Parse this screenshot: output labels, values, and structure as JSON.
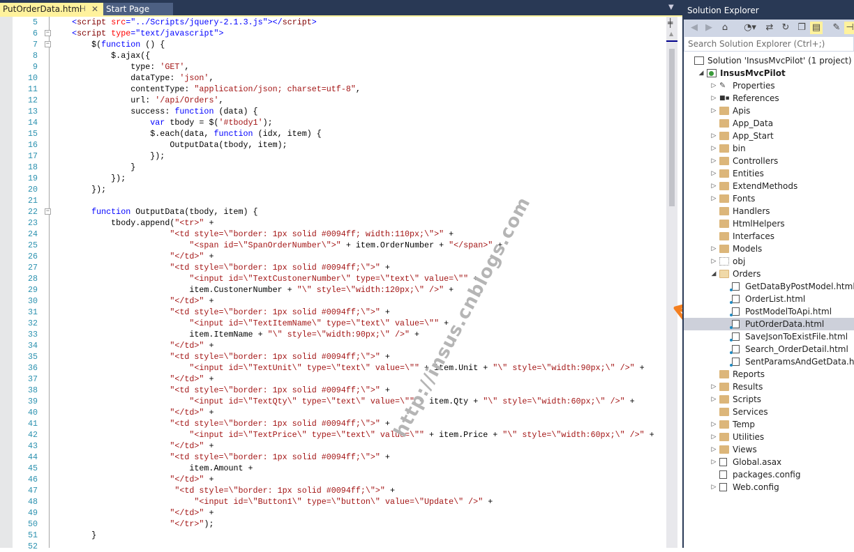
{
  "tabs": {
    "active": "PutOrderData.html",
    "start": "Start Page",
    "pin_icon": "pin-icon",
    "close_icon": "close-icon"
  },
  "code": {
    "lines": [
      {
        "n": "5",
        "html": true,
        "text": "    <script src=\"../Scripts/jquery-2.1.3.js\"></script>"
      },
      {
        "n": "6",
        "html": true,
        "fold": "−",
        "text": "    <script type=\"text/javascript\">"
      },
      {
        "n": "7",
        "fold": "−",
        "text": "        $(function () {"
      },
      {
        "n": "8",
        "text": "            $.ajax({"
      },
      {
        "n": "9",
        "text": "                type: 'GET',"
      },
      {
        "n": "10",
        "text": "                dataType: 'json',"
      },
      {
        "n": "11",
        "text": "                contentType: \"application/json; charset=utf-8\","
      },
      {
        "n": "12",
        "text": "                url: '/api/Orders',"
      },
      {
        "n": "13",
        "text": "                success: function (data) {"
      },
      {
        "n": "14",
        "text": "                    var tbody = $('#tbody1');"
      },
      {
        "n": "15",
        "text": "                    $.each(data, function (idx, item) {"
      },
      {
        "n": "16",
        "text": "                        OutputData(tbody, item);"
      },
      {
        "n": "17",
        "text": "                    });"
      },
      {
        "n": "18",
        "text": "                }"
      },
      {
        "n": "19",
        "text": "            });"
      },
      {
        "n": "20",
        "text": "        });"
      },
      {
        "n": "21",
        "text": ""
      },
      {
        "n": "22",
        "fold": "−",
        "text": "        function OutputData(tbody, item) {"
      },
      {
        "n": "23",
        "text": "            tbody.append(\"<tr>\" +"
      },
      {
        "n": "24",
        "text": "                        \"<td style=\\\"border: 1px solid #0094ff; width:110px;\\\">\" +"
      },
      {
        "n": "25",
        "text": "                            \"<span id=\\\"SpanOrderNumber\\\">\" + item.OrderNumber + \"</span>\" +"
      },
      {
        "n": "26",
        "text": "                        \"</td>\" +"
      },
      {
        "n": "27",
        "text": "                        \"<td style=\\\"border: 1px solid #0094ff;\\\">\" +"
      },
      {
        "n": "28",
        "text": "                            \"<input id=\\\"TextCustonerNumber\\\" type=\\\"text\\\" value=\\\"\" +"
      },
      {
        "n": "29",
        "text": "                            item.CustonerNumber + \"\\\" style=\\\"width:120px;\\\" />\" +"
      },
      {
        "n": "30",
        "text": "                        \"</td>\" +"
      },
      {
        "n": "31",
        "text": "                        \"<td style=\\\"border: 1px solid #0094ff;\\\">\" +"
      },
      {
        "n": "32",
        "text": "                            \"<input id=\\\"TextItemName\\\" type=\\\"text\\\" value=\\\"\" +"
      },
      {
        "n": "33",
        "text": "                            item.ItemName + \"\\\" style=\\\"width:90px;\\\" />\" +"
      },
      {
        "n": "34",
        "text": "                        \"</td>\" +"
      },
      {
        "n": "35",
        "text": "                        \"<td style=\\\"border: 1px solid #0094ff;\\\">\" +"
      },
      {
        "n": "36",
        "text": "                            \"<input id=\\\"TextUnit\\\" type=\\\"text\\\" value=\\\"\" + item.Unit + \"\\\" style=\\\"width:90px;\\\" />\" +"
      },
      {
        "n": "37",
        "text": "                        \"</td>\" +"
      },
      {
        "n": "38",
        "text": "                        \"<td style=\\\"border: 1px solid #0094ff;\\\">\" +"
      },
      {
        "n": "39",
        "text": "                            \"<input id=\\\"TextQty\\\" type=\\\"text\\\" value=\\\"\" + item.Qty + \"\\\" style=\\\"width:60px;\\\" />\" +"
      },
      {
        "n": "40",
        "text": "                        \"</td>\" +"
      },
      {
        "n": "41",
        "text": "                        \"<td style=\\\"border: 1px solid #0094ff;\\\">\" +"
      },
      {
        "n": "42",
        "text": "                            \"<input id=\\\"TextPrice\\\" type=\\\"text\\\" value=\\\"\" + item.Price + \"\\\" style=\\\"width:60px;\\\" />\" +"
      },
      {
        "n": "43",
        "text": "                        \"</td>\" +"
      },
      {
        "n": "44",
        "text": "                        \"<td style=\\\"border: 1px solid #0094ff;\\\">\" +"
      },
      {
        "n": "45",
        "text": "                            item.Amount +"
      },
      {
        "n": "46",
        "text": "                        \"</td>\" +"
      },
      {
        "n": "47",
        "text": "                         \"<td style=\\\"border: 1px solid #0094ff;\\\">\" +"
      },
      {
        "n": "48",
        "text": "                             \"<input id=\\\"Button1\\\" type=\\\"button\\\" value=\\\"Update\\\" />\" +"
      },
      {
        "n": "49",
        "text": "                        \"</td>\" +"
      },
      {
        "n": "50",
        "text": "                        \"</tr>\");"
      },
      {
        "n": "51",
        "text": "        }"
      },
      {
        "n": "52",
        "text": ""
      }
    ]
  },
  "solution_explorer": {
    "title": "Solution Explorer",
    "search_placeholder": "Search Solution Explorer (Ctrl+;)",
    "toolbar": [
      "back-icon",
      "forward-icon",
      "home-icon",
      "history-icon",
      "sync-icon",
      "refresh-icon",
      "collapse-all-icon",
      "show-all-files-icon",
      "properties-wrench-icon",
      "pin-icon"
    ],
    "tree": [
      {
        "label": "Solution 'InsusMvcPilot' (1 project)",
        "depth": 0,
        "exp": "none",
        "icon": "sln"
      },
      {
        "label": "InsusMvcPilot",
        "depth": 1,
        "exp": "expanded",
        "icon": "proj",
        "bold": true
      },
      {
        "label": "Properties",
        "depth": 2,
        "exp": "collapsed",
        "icon": "wrench"
      },
      {
        "label": "References",
        "depth": 2,
        "exp": "collapsed",
        "icon": "refs"
      },
      {
        "label": "Apis",
        "depth": 2,
        "exp": "collapsed",
        "icon": "folder"
      },
      {
        "label": "App_Data",
        "depth": 2,
        "exp": "none",
        "icon": "folder"
      },
      {
        "label": "App_Start",
        "depth": 2,
        "exp": "collapsed",
        "icon": "folder"
      },
      {
        "label": "bin",
        "depth": 2,
        "exp": "collapsed",
        "icon": "folder"
      },
      {
        "label": "Controllers",
        "depth": 2,
        "exp": "collapsed",
        "icon": "folder"
      },
      {
        "label": "Entities",
        "depth": 2,
        "exp": "collapsed",
        "icon": "folder"
      },
      {
        "label": "ExtendMethods",
        "depth": 2,
        "exp": "collapsed",
        "icon": "folder"
      },
      {
        "label": "Fonts",
        "depth": 2,
        "exp": "collapsed",
        "icon": "folder"
      },
      {
        "label": "Handlers",
        "depth": 2,
        "exp": "none",
        "icon": "folder"
      },
      {
        "label": "HtmlHelpers",
        "depth": 2,
        "exp": "none",
        "icon": "folder"
      },
      {
        "label": "Interfaces",
        "depth": 2,
        "exp": "none",
        "icon": "folder"
      },
      {
        "label": "Models",
        "depth": 2,
        "exp": "collapsed",
        "icon": "folder"
      },
      {
        "label": "obj",
        "depth": 2,
        "exp": "collapsed",
        "icon": "folder dotted"
      },
      {
        "label": "Orders",
        "depth": 2,
        "exp": "expanded",
        "icon": "folder open"
      },
      {
        "label": "GetDataByPostModel.html",
        "depth": 3,
        "exp": "none",
        "icon": "file html"
      },
      {
        "label": "OrderList.html",
        "depth": 3,
        "exp": "none",
        "icon": "file html"
      },
      {
        "label": "PostModelToApi.html",
        "depth": 3,
        "exp": "none",
        "icon": "file html"
      },
      {
        "label": "PutOrderData.html",
        "depth": 3,
        "exp": "none",
        "icon": "file html",
        "selected": true
      },
      {
        "label": "SaveJsonToExistFile.html",
        "depth": 3,
        "exp": "none",
        "icon": "file html"
      },
      {
        "label": "Search_OrderDetail.html",
        "depth": 3,
        "exp": "none",
        "icon": "file html"
      },
      {
        "label": "SentParamsAndGetData.html",
        "depth": 3,
        "exp": "none",
        "icon": "file html"
      },
      {
        "label": "Reports",
        "depth": 2,
        "exp": "none",
        "icon": "folder"
      },
      {
        "label": "Results",
        "depth": 2,
        "exp": "collapsed",
        "icon": "folder"
      },
      {
        "label": "Scripts",
        "depth": 2,
        "exp": "collapsed",
        "icon": "folder"
      },
      {
        "label": "Services",
        "depth": 2,
        "exp": "none",
        "icon": "folder"
      },
      {
        "label": "Temp",
        "depth": 2,
        "exp": "collapsed",
        "icon": "folder"
      },
      {
        "label": "Utilities",
        "depth": 2,
        "exp": "collapsed",
        "icon": "folder"
      },
      {
        "label": "Views",
        "depth": 2,
        "exp": "collapsed",
        "icon": "folder"
      },
      {
        "label": "Global.asax",
        "depth": 2,
        "exp": "collapsed",
        "icon": "cfg"
      },
      {
        "label": "packages.config",
        "depth": 2,
        "exp": "none",
        "icon": "cfg"
      },
      {
        "label": "Web.config",
        "depth": 2,
        "exp": "collapsed",
        "icon": "cfg"
      }
    ]
  },
  "watermark": "http://insus.cnblogs.com",
  "colors": {
    "arrow": "#f47f20",
    "tab_active": "#fff29d",
    "chrome": "#293955"
  }
}
